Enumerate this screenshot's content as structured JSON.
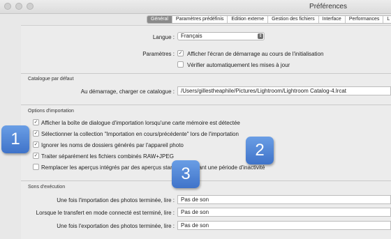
{
  "window": {
    "title": "Préférences"
  },
  "tabs": [
    {
      "label": "Général",
      "active": true
    },
    {
      "label": "Paramètres prédéfinis",
      "active": false
    },
    {
      "label": "Edition externe",
      "active": false
    },
    {
      "label": "Gestion des fichiers",
      "active": false
    },
    {
      "label": "Interface",
      "active": false
    },
    {
      "label": "Performances",
      "active": false
    },
    {
      "label": "L",
      "active": false
    }
  ],
  "general": {
    "language_label": "Langue :",
    "language_value": "Français",
    "settings_label": "Paramètres :",
    "show_splash": {
      "label": "Afficher l'écran de démarrage au cours de l'initialisation",
      "checked": true
    },
    "check_updates": {
      "label": "Vérifier automatiquement les mises à jour",
      "checked": false
    }
  },
  "catalog": {
    "section_title": "Catalogue par défaut",
    "startup_label": "Au démarrage, charger ce catalogue :",
    "startup_value": "/Users/gillestheaphile/Pictures/Lightroom/Lightroom Catalog-4.lrcat"
  },
  "import_options": {
    "section_title": "Options d'importation",
    "items": [
      {
        "label": "Afficher la boîte de dialogue d'importation lorsqu'une carte mémoire est détectée",
        "checked": true
      },
      {
        "label": "Sélectionner la collection \"Importation en cours/précédente\" lors de l'importation",
        "checked": true
      },
      {
        "label": "Ignorer les noms de dossiers générés par l'appareil photo",
        "checked": true
      },
      {
        "label": "Traiter séparément les fichiers combinés RAW+JPEG",
        "checked": true
      },
      {
        "label": "Remplacer les aperçus intégrés par des aperçus standard pendant une période d'inactivité",
        "checked": false
      }
    ]
  },
  "sounds": {
    "section_title": "Sons d'exécution",
    "rows": [
      {
        "label": "Une fois l'importation des photos terminée, lire :",
        "value": "Pas de son"
      },
      {
        "label": "Lorsque le transfert en mode connecté est terminé, lire :",
        "value": "Pas de son"
      },
      {
        "label": "Une fois l'exportation des photos terminée, lire :",
        "value": "Pas de son"
      }
    ]
  },
  "callouts": [
    {
      "number": "1",
      "color": "#4a80d6"
    },
    {
      "number": "2",
      "color": "#4a80d6"
    },
    {
      "number": "3",
      "color": "#4a80d6"
    }
  ]
}
